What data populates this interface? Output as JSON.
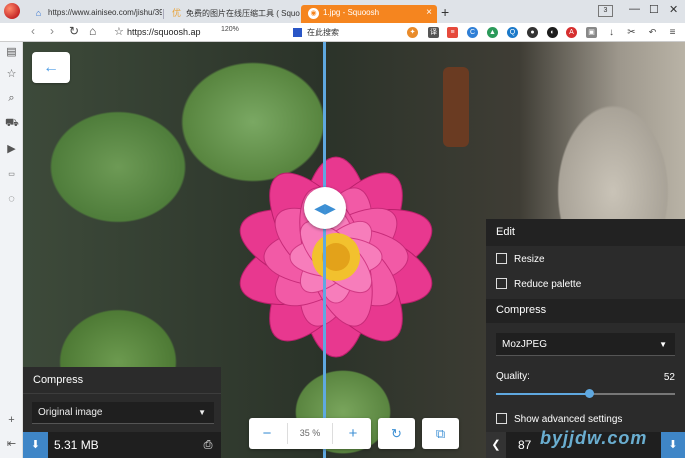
{
  "browser": {
    "tabs": [
      {
        "label": "https://www.ainiseo.com/jishu/39",
        "icon": "home-icon"
      },
      {
        "label": "免费的图片在线压缩工具 ( Squoosh",
        "icon": "site-icon"
      },
      {
        "label": "1.jpg - Squoosh",
        "icon": "squoosh-icon",
        "active": true
      }
    ],
    "tab_count": "3",
    "address": "https://squoosh.ap",
    "zoom": "120%",
    "search_placeholder": "在此搜索",
    "accent_color": "#f5851f"
  },
  "app": {
    "back_label": "←",
    "left_panel": {
      "title": "Compress",
      "selected_option": "Original image",
      "file_size": "5.31 MB"
    },
    "zoom_value": "35",
    "zoom_unit": "%",
    "zoom_out_label": "−",
    "zoom_in_label": "+",
    "right_panel": {
      "edit_title": "Edit",
      "resize_label": "Resize",
      "reduce_palette_label": "Reduce palette",
      "compress_title": "Compress",
      "encoder": "MozJPEG",
      "quality_label": "Quality:",
      "quality_value": "52",
      "quality_fraction": 0.52,
      "advanced_label": "Show advanced settings",
      "file_size": "87"
    },
    "watermark": "byjjdw.com"
  }
}
